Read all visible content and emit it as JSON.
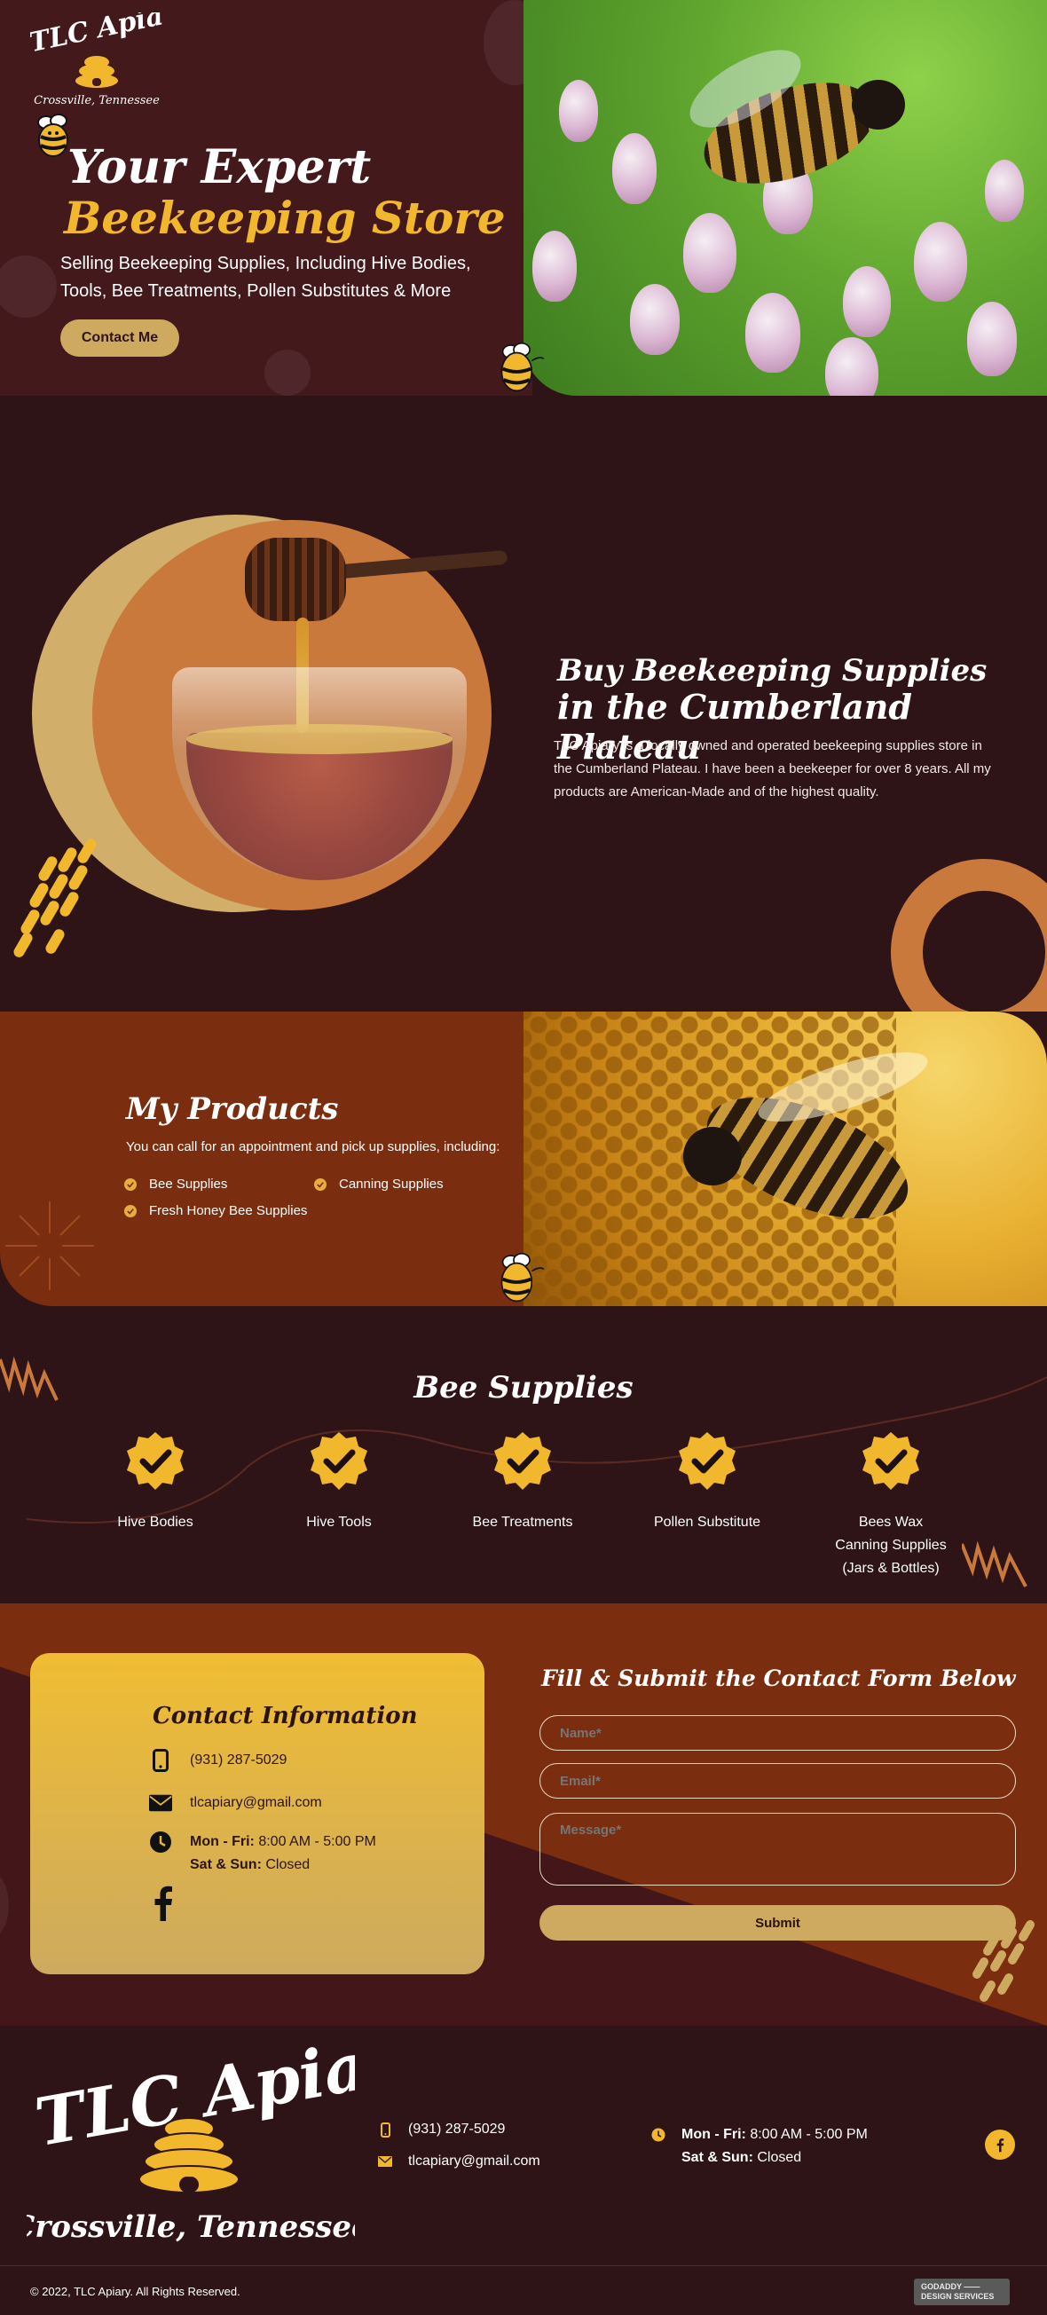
{
  "brand": {
    "name": "TLC Apiary",
    "location": "Crossville, Tennessee"
  },
  "hero": {
    "title_line1": "Your Expert",
    "title_line2": "Beekeeping Store",
    "subtitle": "Selling Beekeeping Supplies, Including Hive Bodies, Tools, Bee Treatments, Pollen Substitutes & More",
    "cta_label": "Contact Me"
  },
  "about": {
    "heading_line1": "Buy Beekeeping Supplies",
    "heading_line2": "in the Cumberland Plateau",
    "body": "TLC Apiary is a locally owned and operated beekeeping supplies store in the Cumberland Plateau. I have been a beekeeper for over 8 years. All my products are American-Made and of the highest quality."
  },
  "products": {
    "heading": "My Products",
    "intro": "You can call for an appointment and pick up supplies, including:",
    "items": [
      "Bee Supplies",
      "Canning Supplies",
      "Fresh Honey Bee Supplies"
    ]
  },
  "supplies": {
    "heading": "Bee Supplies",
    "items": [
      {
        "label": "Hive Bodies"
      },
      {
        "label": "Hive Tools"
      },
      {
        "label": "Bee Treatments"
      },
      {
        "label": "Pollen Substitute"
      },
      {
        "label_lines": [
          "Bees Wax",
          "Canning Supplies",
          "(Jars & Bottles)"
        ]
      }
    ]
  },
  "contact": {
    "card_heading": "Contact Information",
    "phone": "(931) 287-5029",
    "email": "tlcapiary@gmail.com",
    "hours_weekday_label": "Mon - Fri:",
    "hours_weekday": "8:00 AM - 5:00 PM",
    "hours_weekend_label": "Sat & Sun:",
    "hours_weekend": "Closed",
    "form_heading": "Fill & Submit the Contact Form Below",
    "name_placeholder": "Name*",
    "email_placeholder": "Email*",
    "message_placeholder": "Message*",
    "submit_label": "Submit"
  },
  "footer": {
    "phone": "(931) 287-5029",
    "email": "tlcapiary@gmail.com",
    "hours_weekday_label": "Mon - Fri:",
    "hours_weekday": "8:00 AM - 5:00 PM",
    "hours_weekend_label": "Sat & Sun:",
    "hours_weekend": "Closed",
    "copyright": "© 2022, TLC Apiary. All Rights Reserved.",
    "badge_line1": "GODADDY ——",
    "badge_line2": "DESIGN SERVICES"
  },
  "colors": {
    "dark_bg": "#2e1416",
    "hero_panel": "#44191c",
    "rust": "#7a2e0f",
    "gold": "#f2b82d",
    "tan": "#cdaa5f",
    "orange": "#c9793b"
  },
  "icons": {
    "phone": "phone-icon",
    "email": "envelope-icon",
    "hours": "clock-icon",
    "social": "facebook-icon",
    "check": "check-badge-icon"
  }
}
